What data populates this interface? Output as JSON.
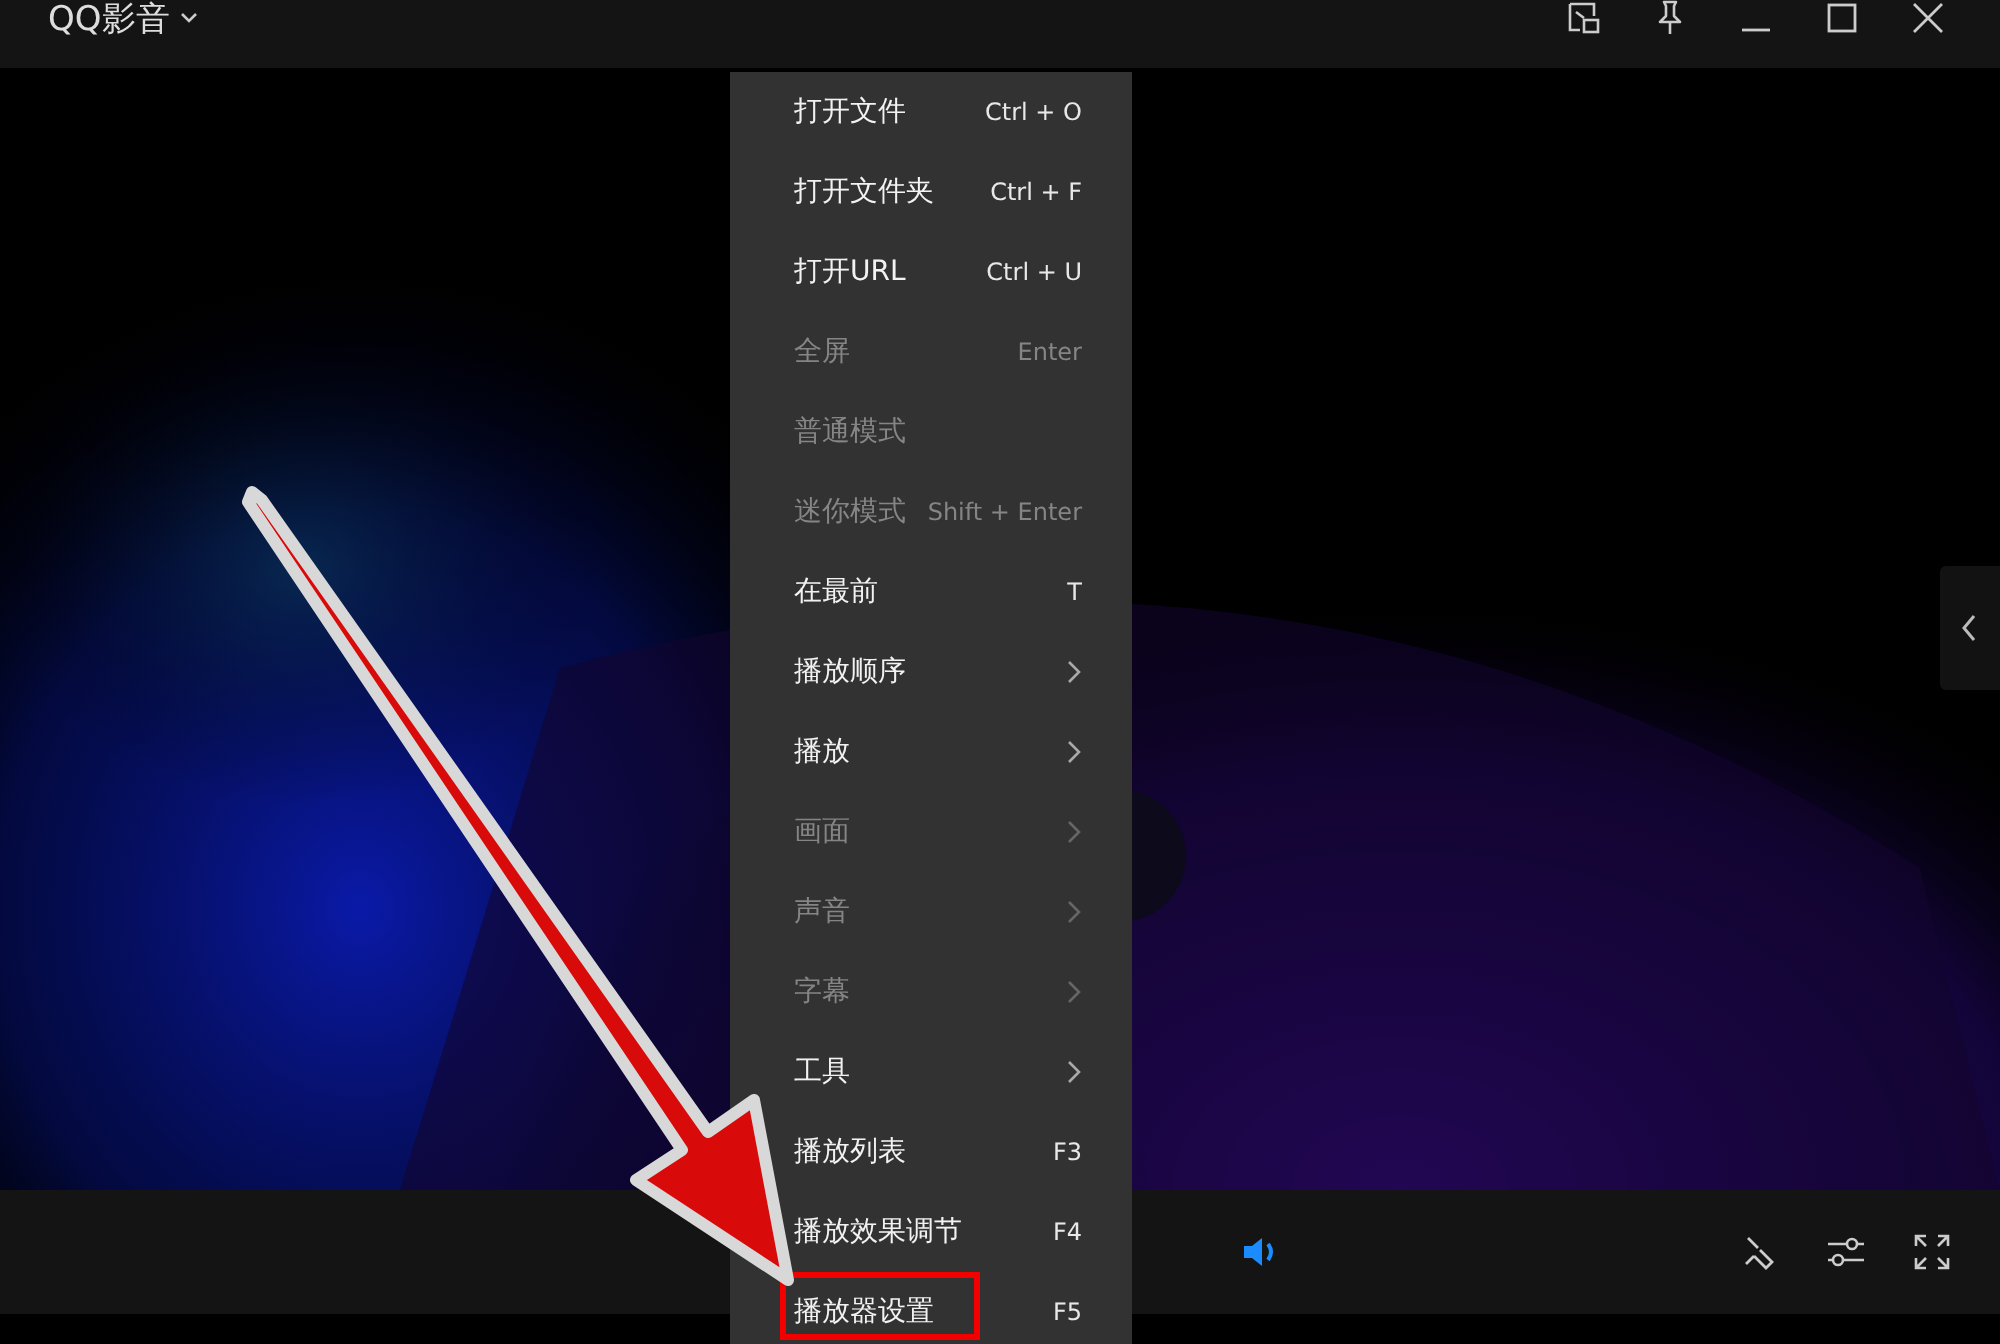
{
  "window": {
    "title": "QQ影音"
  },
  "context_menu": {
    "items": [
      {
        "label": "打开文件",
        "shortcut": "Ctrl + O",
        "disabled": false,
        "submenu": false,
        "outlined": false
      },
      {
        "label": "打开文件夹",
        "shortcut": "Ctrl + F",
        "disabled": false,
        "submenu": false,
        "outlined": false
      },
      {
        "label": "打开URL",
        "shortcut": "Ctrl + U",
        "disabled": false,
        "submenu": false,
        "outlined": false
      },
      {
        "label": "全屏",
        "shortcut": "Enter",
        "disabled": true,
        "submenu": false,
        "outlined": false
      },
      {
        "label": "普通模式",
        "disabled": true,
        "submenu": false,
        "outlined": false
      },
      {
        "label": "迷你模式",
        "shortcut": "Shift + Enter",
        "disabled": true,
        "submenu": false,
        "outlined": false
      },
      {
        "label": "在最前",
        "shortcut": "T",
        "disabled": false,
        "submenu": false,
        "outlined": false
      },
      {
        "label": "播放顺序",
        "disabled": false,
        "submenu": true,
        "outlined": false
      },
      {
        "label": "播放",
        "disabled": false,
        "submenu": true,
        "outlined": false
      },
      {
        "label": "画面",
        "disabled": true,
        "submenu": true,
        "outlined": false
      },
      {
        "label": "声音",
        "disabled": true,
        "submenu": true,
        "outlined": false
      },
      {
        "label": "字幕",
        "disabled": true,
        "submenu": true,
        "outlined": false
      },
      {
        "label": "工具",
        "disabled": false,
        "submenu": true,
        "outlined": false
      },
      {
        "label": "播放列表",
        "shortcut": "F3",
        "disabled": false,
        "submenu": false,
        "outlined": false
      },
      {
        "label": "播放效果调节",
        "shortcut": "F4",
        "disabled": false,
        "submenu": false,
        "outlined": false
      },
      {
        "label": "播放器设置",
        "shortcut": "F5",
        "disabled": false,
        "submenu": false,
        "outlined": true
      }
    ]
  },
  "annotation": {
    "kind": "arrow"
  }
}
